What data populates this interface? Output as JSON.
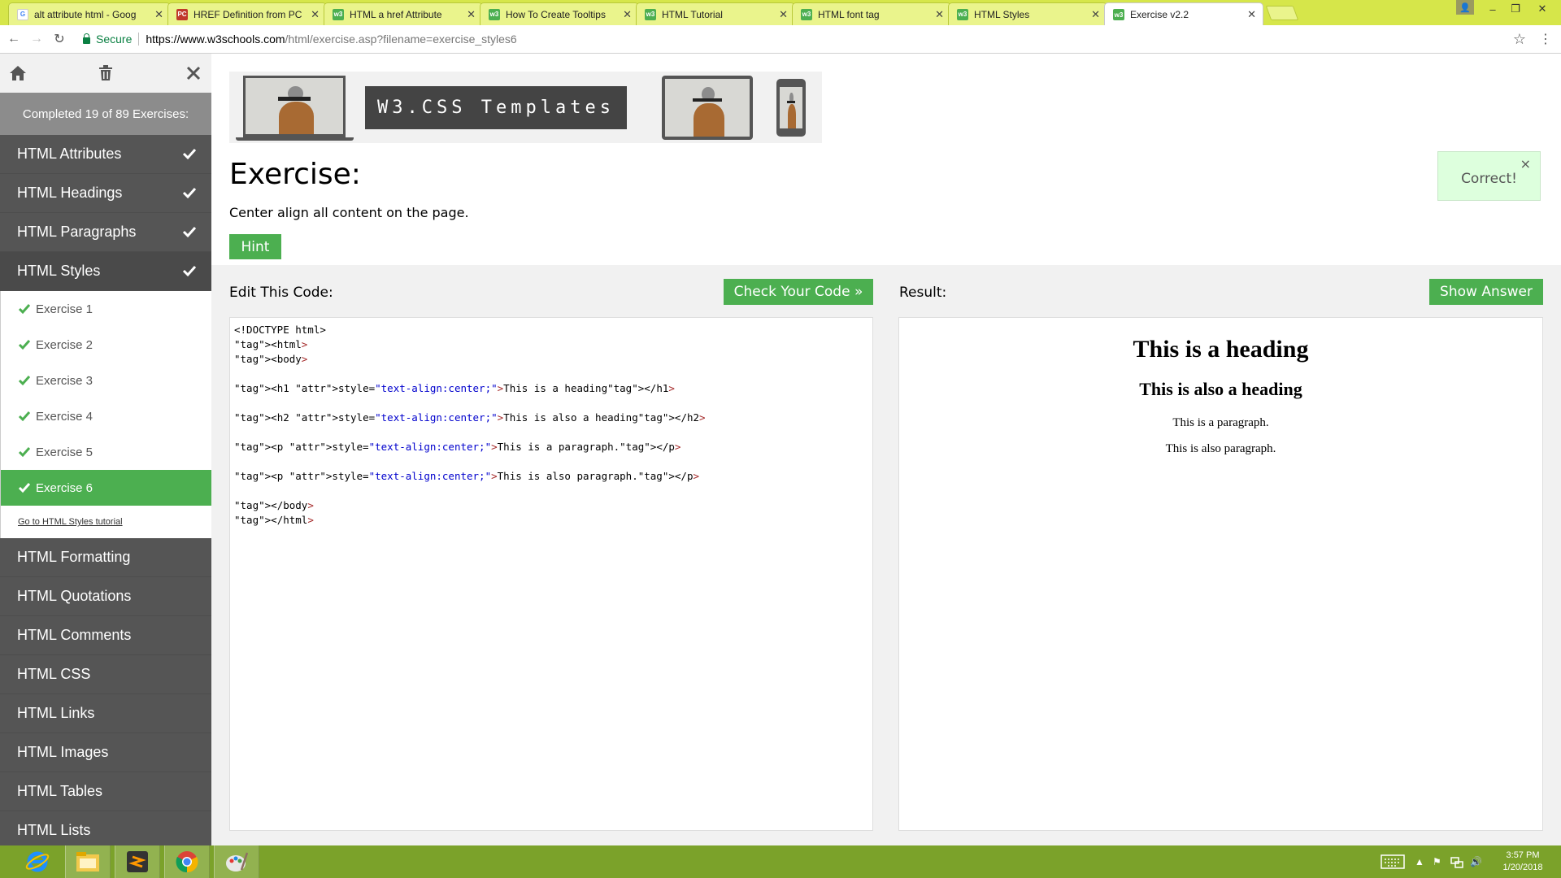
{
  "browser": {
    "tabs": [
      {
        "title": "alt attribute html - Goog",
        "favicon": "google-icon",
        "active": false
      },
      {
        "title": "HREF Definition from PC",
        "favicon": "pc-icon",
        "active": false
      },
      {
        "title": "HTML a href Attribute",
        "favicon": "w3-icon",
        "active": false
      },
      {
        "title": "How To Create Tooltips",
        "favicon": "w3-icon",
        "active": false
      },
      {
        "title": "HTML Tutorial",
        "favicon": "w3-icon",
        "active": false
      },
      {
        "title": "HTML font tag",
        "favicon": "w3-icon",
        "active": false
      },
      {
        "title": "HTML Styles",
        "favicon": "w3-icon",
        "active": false
      },
      {
        "title": "Exercise v2.2",
        "favicon": "w3-icon",
        "active": true
      }
    ],
    "secure_label": "Secure",
    "url_host": "https://www.w3schools.com",
    "url_path": "/html/exercise.asp?filename=exercise_styles6",
    "tab_bar_color": "#d6e64a"
  },
  "sidebar": {
    "progress_text": "Completed 19 of 89 Exercises:",
    "completed_sections": [
      {
        "label": "HTML Attributes"
      },
      {
        "label": "HTML Headings"
      },
      {
        "label": "HTML Paragraphs"
      },
      {
        "label": "HTML Styles"
      }
    ],
    "exercises": [
      {
        "label": "Exercise 1",
        "done": true
      },
      {
        "label": "Exercise 2",
        "done": true
      },
      {
        "label": "Exercise 3",
        "done": true
      },
      {
        "label": "Exercise 4",
        "done": true
      },
      {
        "label": "Exercise 5",
        "done": true
      },
      {
        "label": "Exercise 6",
        "done": true,
        "active": true
      }
    ],
    "tutorial_link": "Go to HTML Styles tutorial",
    "remaining_sections": [
      {
        "label": "HTML Formatting"
      },
      {
        "label": "HTML Quotations"
      },
      {
        "label": "HTML Comments"
      },
      {
        "label": "HTML CSS"
      },
      {
        "label": "HTML Links"
      },
      {
        "label": "HTML Images"
      },
      {
        "label": "HTML Tables"
      },
      {
        "label": "HTML Lists"
      }
    ],
    "colors": {
      "background": "#555555",
      "progress": "#8c8c8c",
      "accent": "#4caf50"
    }
  },
  "banner": {
    "title": "W3.CSS Templates"
  },
  "exercise": {
    "title": "Exercise:",
    "description": "Center align all content on the page.",
    "hint_label": "Hint",
    "correct_text": "Correct!",
    "close_glyph": "×"
  },
  "editor": {
    "label": "Edit This Code:",
    "check_label": "Check Your Code »",
    "code_lines": [
      "<!DOCTYPE html>",
      "<html>",
      "<body>",
      "",
      "<h1 style=\"text-align:center;\">This is a heading</h1>",
      "",
      "<h2 style=\"text-align:center;\">This is also a heading</h2>",
      "",
      "<p style=\"text-align:center;\">This is a paragraph.</p>",
      "",
      "<p style=\"text-align:center;\">This is also paragraph.</p>",
      "",
      "</body>",
      "</html>"
    ]
  },
  "result": {
    "label": "Result:",
    "show_answer_label": "Show Answer",
    "h1": "This is a heading",
    "h2": "This is also a heading",
    "p1": "This is a paragraph.",
    "p2": "This is also paragraph."
  },
  "taskbar": {
    "apps": [
      "internet-explorer-icon",
      "file-explorer-icon",
      "sublime-text-icon",
      "chrome-icon",
      "paint-icon"
    ],
    "time": "3:57 PM",
    "date": "1/20/2018",
    "color": "#7ba22a"
  }
}
